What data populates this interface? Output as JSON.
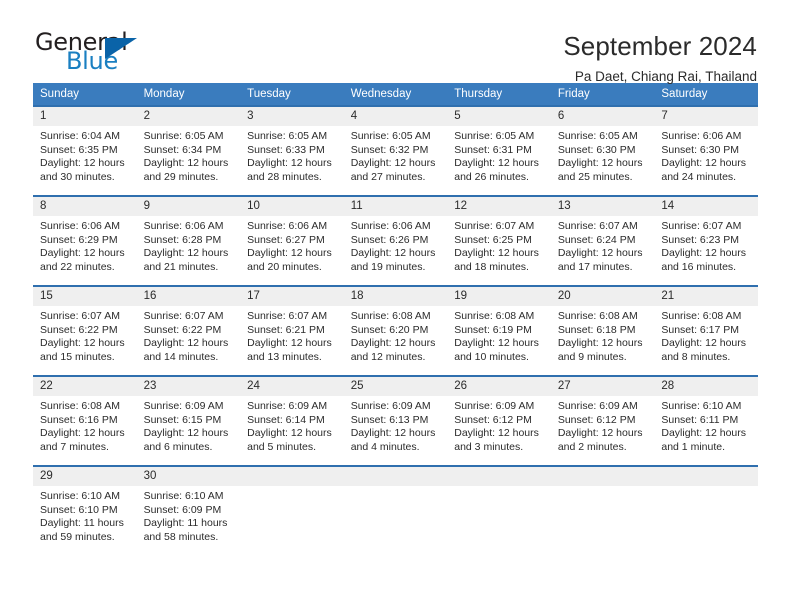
{
  "logo": {
    "line1": "General",
    "line2": "Blue",
    "triangle_color": "#0a63a8",
    "blue_text_color": "#1a7fc1"
  },
  "header": {
    "title": "September 2024",
    "subtitle": "Pa Daet, Chiang Rai, Thailand"
  },
  "theme": {
    "header_bg": "#3a7cbe",
    "row_border": "#2f6fae",
    "daynum_bg": "#efefef",
    "text": "#2b2b2b"
  },
  "calendar": {
    "weekday_headers": [
      "Sunday",
      "Monday",
      "Tuesday",
      "Wednesday",
      "Thursday",
      "Friday",
      "Saturday"
    ],
    "labels": {
      "sunrise": "Sunrise:",
      "sunset": "Sunset:",
      "daylight": "Daylight:"
    },
    "weeks": [
      [
        {
          "day": "1",
          "sunrise": "Sunrise: 6:04 AM",
          "sunset": "Sunset: 6:35 PM",
          "daylight_1": "Daylight: 12 hours",
          "daylight_2": "and 30 minutes."
        },
        {
          "day": "2",
          "sunrise": "Sunrise: 6:05 AM",
          "sunset": "Sunset: 6:34 PM",
          "daylight_1": "Daylight: 12 hours",
          "daylight_2": "and 29 minutes."
        },
        {
          "day": "3",
          "sunrise": "Sunrise: 6:05 AM",
          "sunset": "Sunset: 6:33 PM",
          "daylight_1": "Daylight: 12 hours",
          "daylight_2": "and 28 minutes."
        },
        {
          "day": "4",
          "sunrise": "Sunrise: 6:05 AM",
          "sunset": "Sunset: 6:32 PM",
          "daylight_1": "Daylight: 12 hours",
          "daylight_2": "and 27 minutes."
        },
        {
          "day": "5",
          "sunrise": "Sunrise: 6:05 AM",
          "sunset": "Sunset: 6:31 PM",
          "daylight_1": "Daylight: 12 hours",
          "daylight_2": "and 26 minutes."
        },
        {
          "day": "6",
          "sunrise": "Sunrise: 6:05 AM",
          "sunset": "Sunset: 6:30 PM",
          "daylight_1": "Daylight: 12 hours",
          "daylight_2": "and 25 minutes."
        },
        {
          "day": "7",
          "sunrise": "Sunrise: 6:06 AM",
          "sunset": "Sunset: 6:30 PM",
          "daylight_1": "Daylight: 12 hours",
          "daylight_2": "and 24 minutes."
        }
      ],
      [
        {
          "day": "8",
          "sunrise": "Sunrise: 6:06 AM",
          "sunset": "Sunset: 6:29 PM",
          "daylight_1": "Daylight: 12 hours",
          "daylight_2": "and 22 minutes."
        },
        {
          "day": "9",
          "sunrise": "Sunrise: 6:06 AM",
          "sunset": "Sunset: 6:28 PM",
          "daylight_1": "Daylight: 12 hours",
          "daylight_2": "and 21 minutes."
        },
        {
          "day": "10",
          "sunrise": "Sunrise: 6:06 AM",
          "sunset": "Sunset: 6:27 PM",
          "daylight_1": "Daylight: 12 hours",
          "daylight_2": "and 20 minutes."
        },
        {
          "day": "11",
          "sunrise": "Sunrise: 6:06 AM",
          "sunset": "Sunset: 6:26 PM",
          "daylight_1": "Daylight: 12 hours",
          "daylight_2": "and 19 minutes."
        },
        {
          "day": "12",
          "sunrise": "Sunrise: 6:07 AM",
          "sunset": "Sunset: 6:25 PM",
          "daylight_1": "Daylight: 12 hours",
          "daylight_2": "and 18 minutes."
        },
        {
          "day": "13",
          "sunrise": "Sunrise: 6:07 AM",
          "sunset": "Sunset: 6:24 PM",
          "daylight_1": "Daylight: 12 hours",
          "daylight_2": "and 17 minutes."
        },
        {
          "day": "14",
          "sunrise": "Sunrise: 6:07 AM",
          "sunset": "Sunset: 6:23 PM",
          "daylight_1": "Daylight: 12 hours",
          "daylight_2": "and 16 minutes."
        }
      ],
      [
        {
          "day": "15",
          "sunrise": "Sunrise: 6:07 AM",
          "sunset": "Sunset: 6:22 PM",
          "daylight_1": "Daylight: 12 hours",
          "daylight_2": "and 15 minutes."
        },
        {
          "day": "16",
          "sunrise": "Sunrise: 6:07 AM",
          "sunset": "Sunset: 6:22 PM",
          "daylight_1": "Daylight: 12 hours",
          "daylight_2": "and 14 minutes."
        },
        {
          "day": "17",
          "sunrise": "Sunrise: 6:07 AM",
          "sunset": "Sunset: 6:21 PM",
          "daylight_1": "Daylight: 12 hours",
          "daylight_2": "and 13 minutes."
        },
        {
          "day": "18",
          "sunrise": "Sunrise: 6:08 AM",
          "sunset": "Sunset: 6:20 PM",
          "daylight_1": "Daylight: 12 hours",
          "daylight_2": "and 12 minutes."
        },
        {
          "day": "19",
          "sunrise": "Sunrise: 6:08 AM",
          "sunset": "Sunset: 6:19 PM",
          "daylight_1": "Daylight: 12 hours",
          "daylight_2": "and 10 minutes."
        },
        {
          "day": "20",
          "sunrise": "Sunrise: 6:08 AM",
          "sunset": "Sunset: 6:18 PM",
          "daylight_1": "Daylight: 12 hours",
          "daylight_2": "and 9 minutes."
        },
        {
          "day": "21",
          "sunrise": "Sunrise: 6:08 AM",
          "sunset": "Sunset: 6:17 PM",
          "daylight_1": "Daylight: 12 hours",
          "daylight_2": "and 8 minutes."
        }
      ],
      [
        {
          "day": "22",
          "sunrise": "Sunrise: 6:08 AM",
          "sunset": "Sunset: 6:16 PM",
          "daylight_1": "Daylight: 12 hours",
          "daylight_2": "and 7 minutes."
        },
        {
          "day": "23",
          "sunrise": "Sunrise: 6:09 AM",
          "sunset": "Sunset: 6:15 PM",
          "daylight_1": "Daylight: 12 hours",
          "daylight_2": "and 6 minutes."
        },
        {
          "day": "24",
          "sunrise": "Sunrise: 6:09 AM",
          "sunset": "Sunset: 6:14 PM",
          "daylight_1": "Daylight: 12 hours",
          "daylight_2": "and 5 minutes."
        },
        {
          "day": "25",
          "sunrise": "Sunrise: 6:09 AM",
          "sunset": "Sunset: 6:13 PM",
          "daylight_1": "Daylight: 12 hours",
          "daylight_2": "and 4 minutes."
        },
        {
          "day": "26",
          "sunrise": "Sunrise: 6:09 AM",
          "sunset": "Sunset: 6:12 PM",
          "daylight_1": "Daylight: 12 hours",
          "daylight_2": "and 3 minutes."
        },
        {
          "day": "27",
          "sunrise": "Sunrise: 6:09 AM",
          "sunset": "Sunset: 6:12 PM",
          "daylight_1": "Daylight: 12 hours",
          "daylight_2": "and 2 minutes."
        },
        {
          "day": "28",
          "sunrise": "Sunrise: 6:10 AM",
          "sunset": "Sunset: 6:11 PM",
          "daylight_1": "Daylight: 12 hours",
          "daylight_2": "and 1 minute."
        }
      ],
      [
        {
          "day": "29",
          "sunrise": "Sunrise: 6:10 AM",
          "sunset": "Sunset: 6:10 PM",
          "daylight_1": "Daylight: 11 hours",
          "daylight_2": "and 59 minutes."
        },
        {
          "day": "30",
          "sunrise": "Sunrise: 6:10 AM",
          "sunset": "Sunset: 6:09 PM",
          "daylight_1": "Daylight: 11 hours",
          "daylight_2": "and 58 minutes."
        },
        {
          "day": "",
          "sunrise": "",
          "sunset": "",
          "daylight_1": "",
          "daylight_2": ""
        },
        {
          "day": "",
          "sunrise": "",
          "sunset": "",
          "daylight_1": "",
          "daylight_2": ""
        },
        {
          "day": "",
          "sunrise": "",
          "sunset": "",
          "daylight_1": "",
          "daylight_2": ""
        },
        {
          "day": "",
          "sunrise": "",
          "sunset": "",
          "daylight_1": "",
          "daylight_2": ""
        },
        {
          "day": "",
          "sunrise": "",
          "sunset": "",
          "daylight_1": "",
          "daylight_2": ""
        }
      ]
    ]
  }
}
